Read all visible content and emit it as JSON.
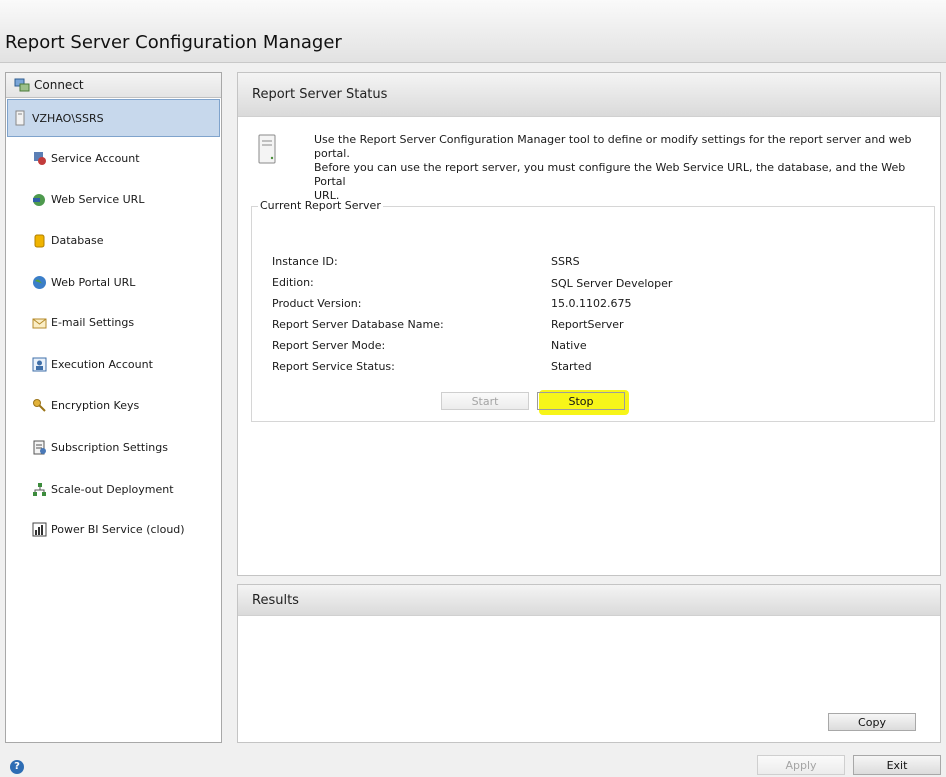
{
  "app": {
    "title": "Report Server Configuration Manager"
  },
  "sidebar": {
    "connect_label": "Connect",
    "server": "VZHAO\\SSRS",
    "items": [
      {
        "label": "Service Account",
        "icon": "service-account-icon"
      },
      {
        "label": "Web Service URL",
        "icon": "web-service-url-icon"
      },
      {
        "label": "Database",
        "icon": "database-icon"
      },
      {
        "label": "Web Portal URL",
        "icon": "globe-icon"
      },
      {
        "label": "E-mail Settings",
        "icon": "email-icon"
      },
      {
        "label": "Execution Account",
        "icon": "execution-account-icon"
      },
      {
        "label": "Encryption Keys",
        "icon": "keys-icon"
      },
      {
        "label": "Subscription Settings",
        "icon": "subscription-icon"
      },
      {
        "label": "Scale-out Deployment",
        "icon": "scale-out-icon"
      },
      {
        "label": "Power BI Service (cloud)",
        "icon": "powerbi-icon"
      }
    ]
  },
  "status": {
    "header": "Report Server Status",
    "info_line1": "Use the Report Server Configuration Manager tool to define or modify settings for the report server and web portal.",
    "info_line2": "Before you can use the report server, you must configure the Web Service URL, the database, and the Web Portal",
    "info_line3": "URL.",
    "group_title": "Current Report Server",
    "fields": [
      {
        "label": "Instance ID:",
        "value": "SSRS"
      },
      {
        "label": "Edition:",
        "value": "SQL Server Developer"
      },
      {
        "label": "Product Version:",
        "value": "15.0.1102.675"
      },
      {
        "label": "Report Server Database Name:",
        "value": "ReportServer"
      },
      {
        "label": "Report Server Mode:",
        "value": "Native"
      },
      {
        "label": "Report Service Status:",
        "value": "Started"
      }
    ],
    "start_label": "Start",
    "stop_label": "Stop"
  },
  "results": {
    "header": "Results",
    "copy_label": "Copy"
  },
  "footer": {
    "apply_label": "Apply",
    "exit_label": "Exit"
  },
  "colors": {
    "highlight": "#f6f400",
    "selection": "#c7d8ec"
  }
}
